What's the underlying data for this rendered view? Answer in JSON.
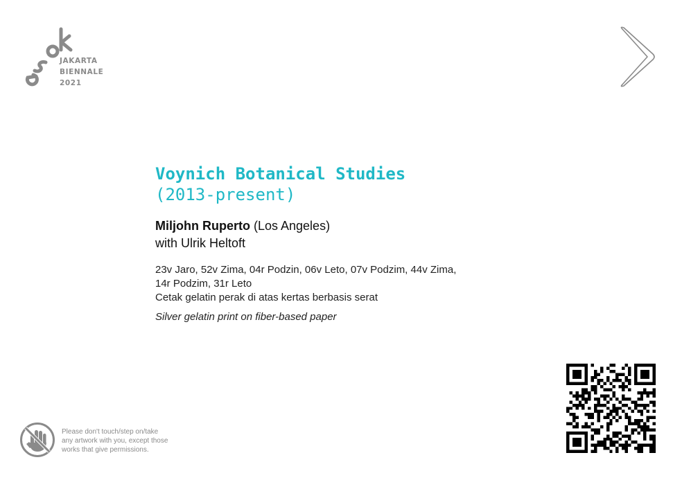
{
  "logo": {
    "mark": "esok",
    "line1": "JAKARTA",
    "line2": "BIENNALE",
    "line3": "2021",
    "color": "#8a8a8a"
  },
  "navigation": {
    "next_icon": "chevron-right-icon"
  },
  "artwork": {
    "title": "Voynich Botanical Studies",
    "years": "(2013-present)",
    "artist_name": "Miljohn Ruperto",
    "artist_location": "(Los Angeles)",
    "collaborator": "with Ulrik Heltoft",
    "works_line1": "23v Jaro, 52v Zima, 04r Podzin, 06v Leto, 07v Podzim, 44v Zima,",
    "works_line2": "14r Podzim, 31r Leto",
    "medium_id": "Cetak gelatin perak di atas kertas berbasis serat",
    "medium_en": "Silver gelatin print on fiber-based paper",
    "accent_color": "#1fb8c6"
  },
  "notice": {
    "icon": "no-touch-hand-icon",
    "line1": "Please don't touch/step on/take",
    "line2": "any artwork with you, except those",
    "line3": "works that give permissions."
  },
  "qr": {
    "icon": "qr-code"
  }
}
